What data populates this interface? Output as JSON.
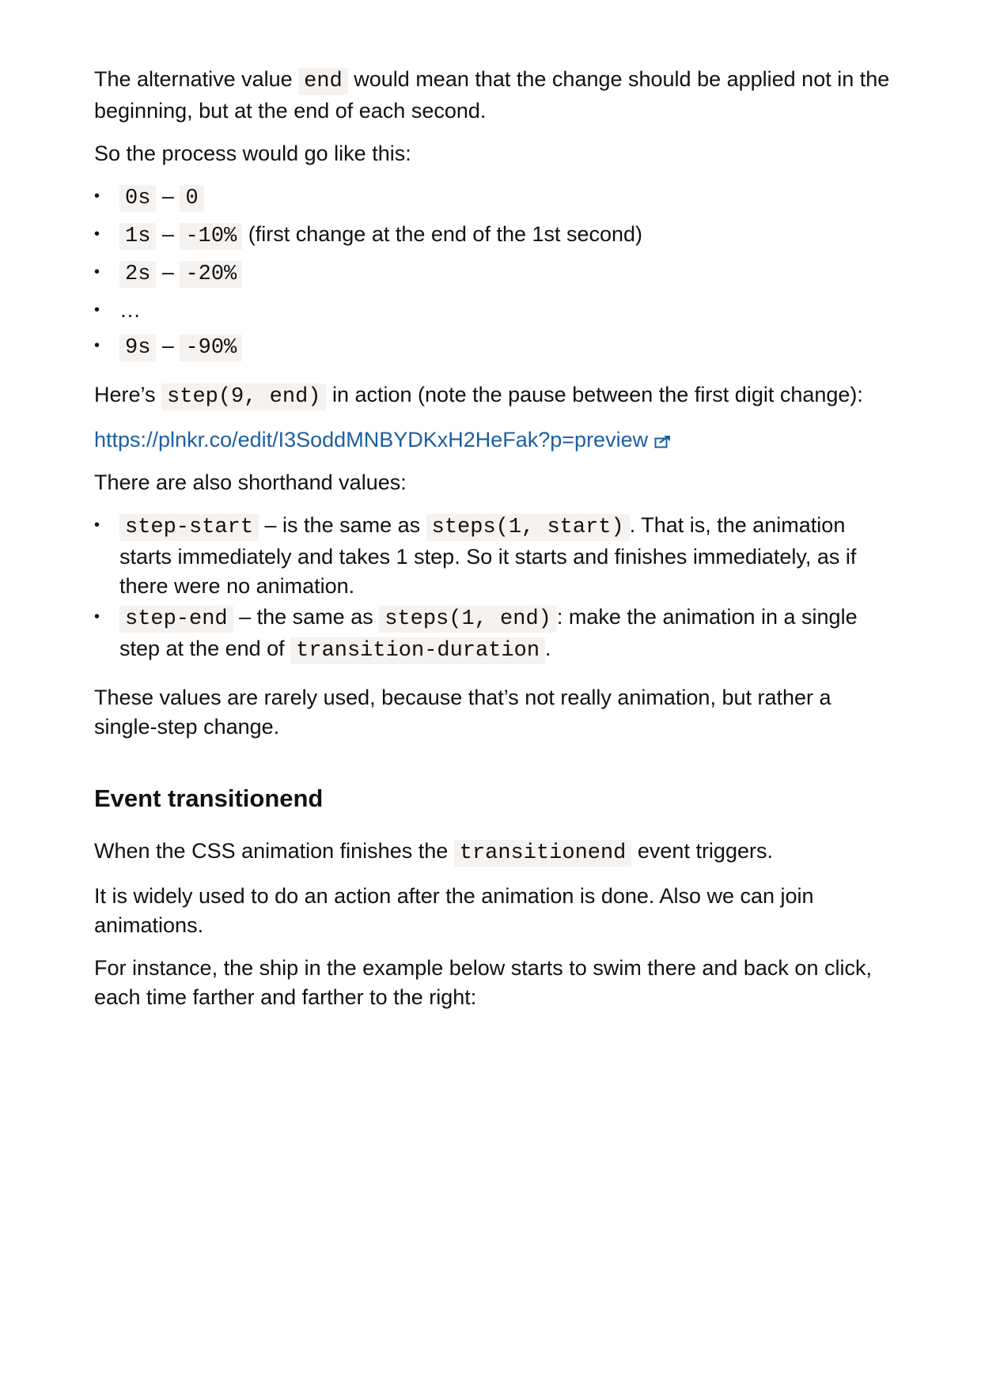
{
  "p1": {
    "before": "The alternative value ",
    "code": "end",
    "after": " would mean that the change should be applied not in the beginning, but at the end of each second."
  },
  "p2": "So the process would go like this:",
  "steps": [
    {
      "t": "0s",
      "sep": " – ",
      "v": "0",
      "note": ""
    },
    {
      "t": "1s",
      "sep": " – ",
      "v": "-10%",
      "note": " (first change at the end of the 1st second)"
    },
    {
      "t": "2s",
      "sep": " – ",
      "v": "-20%",
      "note": ""
    },
    {
      "ellipsis": "…"
    },
    {
      "t": "9s",
      "sep": " – ",
      "v": "-90%",
      "note": ""
    }
  ],
  "p3": {
    "before": "Here’s ",
    "code": "step(9, end)",
    "after": " in action (note the pause between the first digit change):"
  },
  "link": {
    "text": "https://plnkr.co/edit/I3SoddMNBYDKxH2HeFak?p=preview"
  },
  "p4": "There are also shorthand values:",
  "shorthands": [
    {
      "code": "step-start",
      "mid": " – is the same as ",
      "code2": "steps(1, start)",
      "after": ". That is, the animation starts immediately and takes 1 step. So it starts and finishes immediately, as if there were no animation."
    },
    {
      "code": "step-end",
      "mid": " – the same as ",
      "code2": "steps(1, end)",
      "after": ": make the animation in a single step at the end of ",
      "code3": "transition-duration",
      "end": "."
    }
  ],
  "p5": "These values are rarely used, because that’s not really animation, but rather a single-step change.",
  "heading": "Event transitionend",
  "p6": {
    "before": "When the CSS animation finishes the ",
    "code": "transitionend",
    "after": " event triggers."
  },
  "p7": "It is widely used to do an action after the animation is done. Also we can join animations.",
  "p8": "For instance, the ship in the example below starts to swim there and back on click, each time farther and farther to the right:",
  "bullet_glyph": "•",
  "colors": {
    "link": "#1d5fa0",
    "code_bg": "#f5f2f0"
  }
}
